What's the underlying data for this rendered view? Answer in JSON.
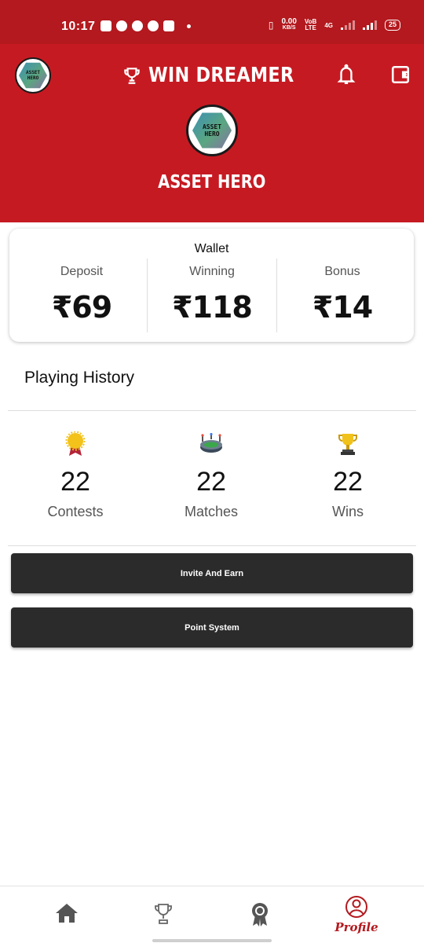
{
  "status_bar": {
    "time": "10:17",
    "speed_value": "0.00",
    "speed_unit": "KB/S",
    "network_volte": "VoB",
    "network_lte": "LTE",
    "network_type": "4G",
    "battery": "25"
  },
  "header": {
    "app_title": "WIN DREAMER",
    "avatar_text_line1": "ASSET",
    "avatar_text_line2": "HERO",
    "profile_name": "ASSET HERO",
    "color": "#c61a22"
  },
  "wallet": {
    "title": "Wallet",
    "columns": [
      {
        "label": "Deposit",
        "amount": "₹69"
      },
      {
        "label": "Winning",
        "amount": "₹118"
      },
      {
        "label": "Bonus",
        "amount": "₹14"
      }
    ]
  },
  "history": {
    "title": "Playing History",
    "stats": [
      {
        "icon": "medal-icon",
        "value": "22",
        "label": "Contests"
      },
      {
        "icon": "stadium-icon",
        "value": "22",
        "label": "Matches"
      },
      {
        "icon": "trophy-icon",
        "value": "22",
        "label": "Wins"
      }
    ]
  },
  "buttons": {
    "invite": "Invite And Earn",
    "points": "Point System"
  },
  "bottom_nav": {
    "items": [
      {
        "icon": "home-icon"
      },
      {
        "icon": "trophy-outline-icon"
      },
      {
        "icon": "badge-icon"
      },
      {
        "icon": "profile-icon",
        "label": "Profile",
        "active": true
      }
    ]
  }
}
